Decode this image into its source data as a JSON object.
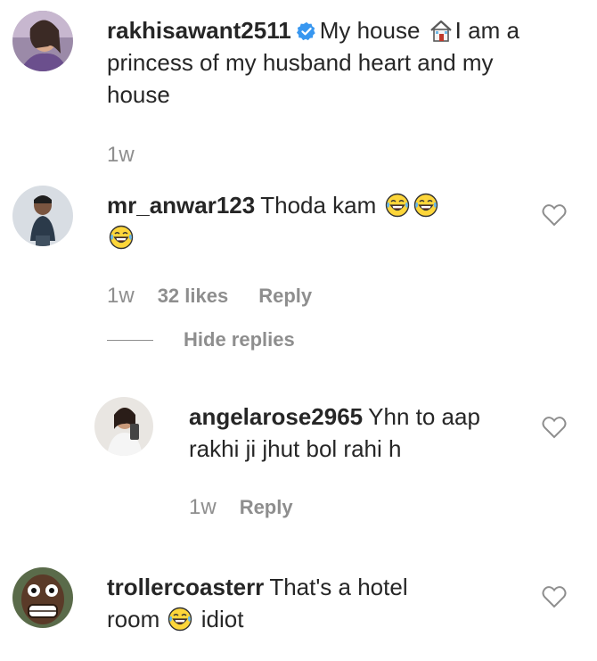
{
  "comments": [
    {
      "username": "rakhisawant2511",
      "verified": true,
      "text_part1": "My house ",
      "text_emoji": "house-icon",
      "text_part2": "I am a princess of my husband heart and my house",
      "time": "1w"
    },
    {
      "username": "mr_anwar123",
      "text": "Thoda kam",
      "emojis": [
        "tears-of-joy-emoji",
        "tears-of-joy-emoji",
        "tears-of-joy-emoji"
      ],
      "time": "1w",
      "likes": "32 likes",
      "reply_label": "Reply"
    },
    {
      "username": "angelarose2965",
      "text": "Yhn to aap rakhi ji jhut bol rahi h",
      "time": "1w",
      "reply_label": "Reply"
    },
    {
      "username": "trollercoasterr",
      "text_part1": "That's a hotel room",
      "emoji": "tears-of-joy-emoji",
      "text_part2": "idiot"
    }
  ],
  "hide_replies_label": "Hide replies",
  "colors": {
    "text": "#262626",
    "meta": "#8e8e8e",
    "verified": "#3897f0",
    "heart_outline": "#8e8e8e"
  }
}
